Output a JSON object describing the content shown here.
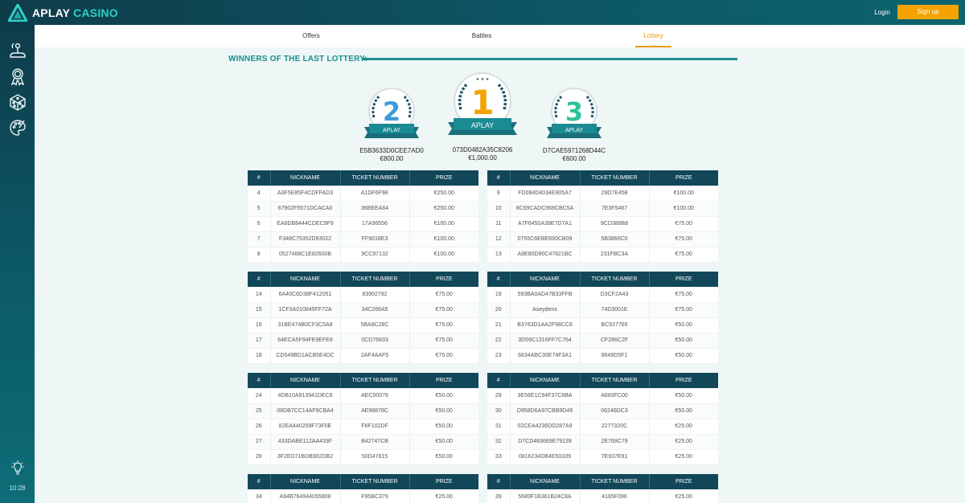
{
  "header": {
    "logo_text_a": "APLAY",
    "logo_text_b": "CASINO",
    "login_label": "Login",
    "signup_label": "Sign up"
  },
  "sidebar": {
    "icons": [
      "joystick-icon",
      "award-icon",
      "dice-icon",
      "palette-icon"
    ],
    "time": "10:28"
  },
  "tabs": [
    {
      "label": "Offers",
      "active": false
    },
    {
      "label": "Battles",
      "active": false
    },
    {
      "label": "Lottery",
      "active": true
    }
  ],
  "winners": {
    "title": "WINNERS OF THE LAST LOTTERY:",
    "podium": [
      {
        "place": "2",
        "brand": "APLAY",
        "nickname": "E5B3633D0CEE7AD0",
        "prize": "€800.00"
      },
      {
        "place": "1",
        "brand": "APLAY",
        "nickname": "073D0482A35C8206",
        "prize": "€1,000.00"
      },
      {
        "place": "3",
        "brand": "APLAY",
        "nickname": "D7CAE5971268D44C",
        "prize": "€600.00"
      }
    ]
  },
  "table_headers": [
    "#",
    "NICKNAME",
    "TICKET NUMBER",
    "PRIZE"
  ],
  "tables": [
    {
      "rows": [
        [
          "4",
          "A3F5E85F4CDFFAD3",
          "A1DF6F9E",
          "€250.00"
        ],
        [
          "5",
          "67902F5571DCACA0",
          "36BEEA64",
          "€250.00"
        ],
        [
          "6",
          "EA8DB8444CDEC9F9",
          "17A96556",
          "€100.00"
        ],
        [
          "7",
          "F348C75352D93022",
          "FF9018E3",
          "€100.00"
        ],
        [
          "8",
          "0527468C1E82600B",
          "9CC97132",
          "€100.00"
        ]
      ]
    },
    {
      "rows": [
        [
          "9",
          "FD084D4034E905A7",
          "29D7E458",
          "€100.00"
        ],
        [
          "10",
          "8C69CADC968CBC5A",
          "7E3F5467",
          "€100.00"
        ],
        [
          "11",
          "A7F6450A39E7D7A1",
          "9CD386B8",
          "€75.00"
        ],
        [
          "12",
          "0755C6EBE690CB09",
          "5B3866C0",
          "€75.00"
        ],
        [
          "13",
          "A9E80D90C47821BC",
          "231FBC3A",
          "€75.00"
        ]
      ]
    },
    {
      "rows": [
        [
          "14",
          "6A40C6D38F412051",
          "83902792",
          "€75.00"
        ],
        [
          "15",
          "1CF3A010845FF72A",
          "34C266A5",
          "€75.00"
        ],
        [
          "16",
          "31BE474B0CF3C5A8",
          "5BA8C28C",
          "€75.00"
        ],
        [
          "17",
          "64ECA5F94FE9EFE8",
          "0CD76833",
          "€75.00"
        ],
        [
          "18",
          "CD549BD1ACB5E4DC",
          "2AF4AAF5",
          "€75.00"
        ]
      ]
    },
    {
      "rows": [
        [
          "19",
          "593BA0AD47B33FFB",
          "D3CF2A43",
          "€75.00"
        ],
        [
          "20",
          "Aseydenx",
          "74D3001E",
          "€75.00"
        ],
        [
          "21",
          "B3763D1AA2F98CC8",
          "BC927765",
          "€50.00"
        ],
        [
          "22",
          "3D59C1316FF7C764",
          "CF286C2F",
          "€50.00"
        ],
        [
          "23",
          "6834ABC30E74F3A1",
          "8649D5F1",
          "€50.00"
        ]
      ]
    },
    {
      "rows": [
        [
          "24",
          "4DB10A913941DEC6",
          "AEC00078",
          "€50.00"
        ],
        [
          "25",
          "08DB7CC14AF9CBA4",
          "AE98878C",
          "€50.00"
        ],
        [
          "26",
          "82EA440209F73F0E",
          "F6F102DF",
          "€50.00"
        ],
        [
          "27",
          "433DABE112AA433F",
          "B42747CB",
          "€50.00"
        ],
        [
          "28",
          "3F2ED71BDB902DB2",
          "50D47815",
          "€50.00"
        ]
      ]
    },
    {
      "rows": [
        [
          "29",
          "3E56E1C94F37C8BA",
          "A683FC00",
          "€50.00"
        ],
        [
          "30",
          "D958D6A97CBB9D49",
          "06246DC3",
          "€50.00"
        ],
        [
          "31",
          "02CEA4236DD287A9",
          "2277320C",
          "€25.00"
        ],
        [
          "32",
          "D7CD483669E79139",
          "2E769C79",
          "€25.00"
        ],
        [
          "33",
          "0816234DB4E50339",
          "7E937E91",
          "€25.00"
        ]
      ]
    },
    {
      "rows": [
        [
          "34",
          "A94B764944055808",
          "F95BC379",
          "€25.00"
        ]
      ]
    },
    {
      "rows": [
        [
          "39",
          "5689F1B361B24C8A",
          "4165F096",
          "€25.00"
        ]
      ]
    }
  ]
}
